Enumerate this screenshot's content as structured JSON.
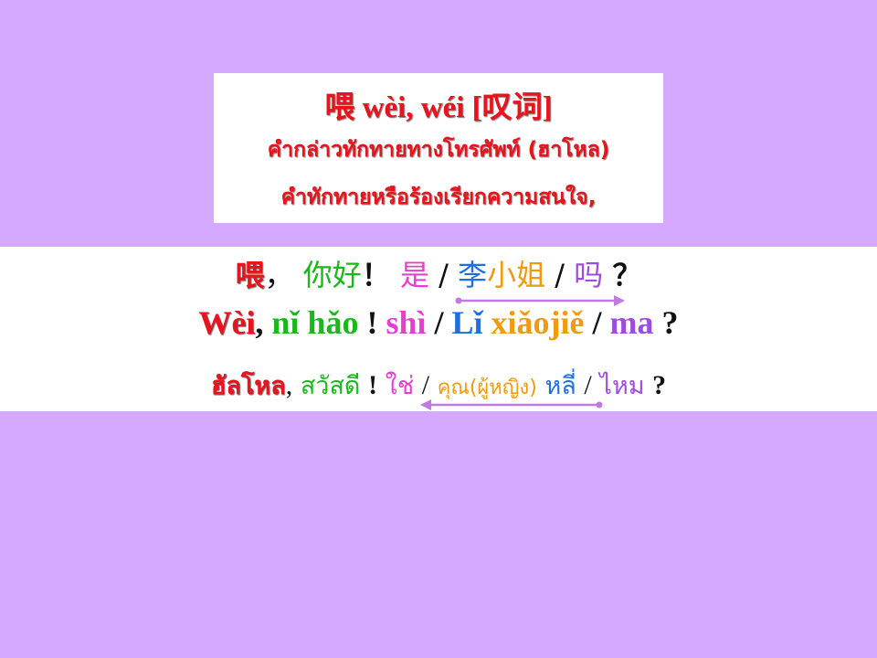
{
  "title_box": {
    "headline": "喂  wèi, wéi [叹词]",
    "meaning_1": "คำกล่าวทักทายทางโทรศัพท์ (ฮาโหล)",
    "meaning_2": "คำทักทายหรือร้องเรียกความสนใจ,"
  },
  "sentence": {
    "hanzi": {
      "wei": "喂",
      "comma": "，",
      "nihao": "你好",
      "excl": "！",
      "shi": "是",
      "slash1": "/",
      "li": "李",
      "xiaojie": "小姐",
      "slash2": "/",
      "slash_mid": "/",
      "ma": "吗",
      "q": "？"
    },
    "pinyin": {
      "wei": "Wèi",
      "comma": ",",
      "nihao": "nǐ hǎo",
      "excl": "!",
      "shi": "shì",
      "slash1": "/",
      "li": "Lǐ",
      "xiaojie": "xiǎojiě",
      "slash2": "/",
      "ma": "ma",
      "q": "?"
    },
    "thai": {
      "wei": "ฮัลโหล",
      "comma": ",",
      "nihao": "สวัสดี",
      "excl": "!",
      "shi": "ใช่",
      "slash1": "/",
      "xiaojie": "คุณ(ผู้หญิง)",
      "li": "หลี่",
      "slash2": "/",
      "ma": "ไหม",
      "q": "?"
    }
  },
  "colors": {
    "background": "#d4a9ff",
    "red": "#e8131c",
    "green": "#1bb81b",
    "pink": "#e63fd0",
    "blue": "#1f6fe0",
    "orange": "#f09a10",
    "purple": "#9c4de0",
    "arrow": "#c07ae0"
  },
  "icons": {
    "arrow_right": "double-headed-arrow-icon",
    "arrow_left": "double-headed-arrow-icon"
  }
}
